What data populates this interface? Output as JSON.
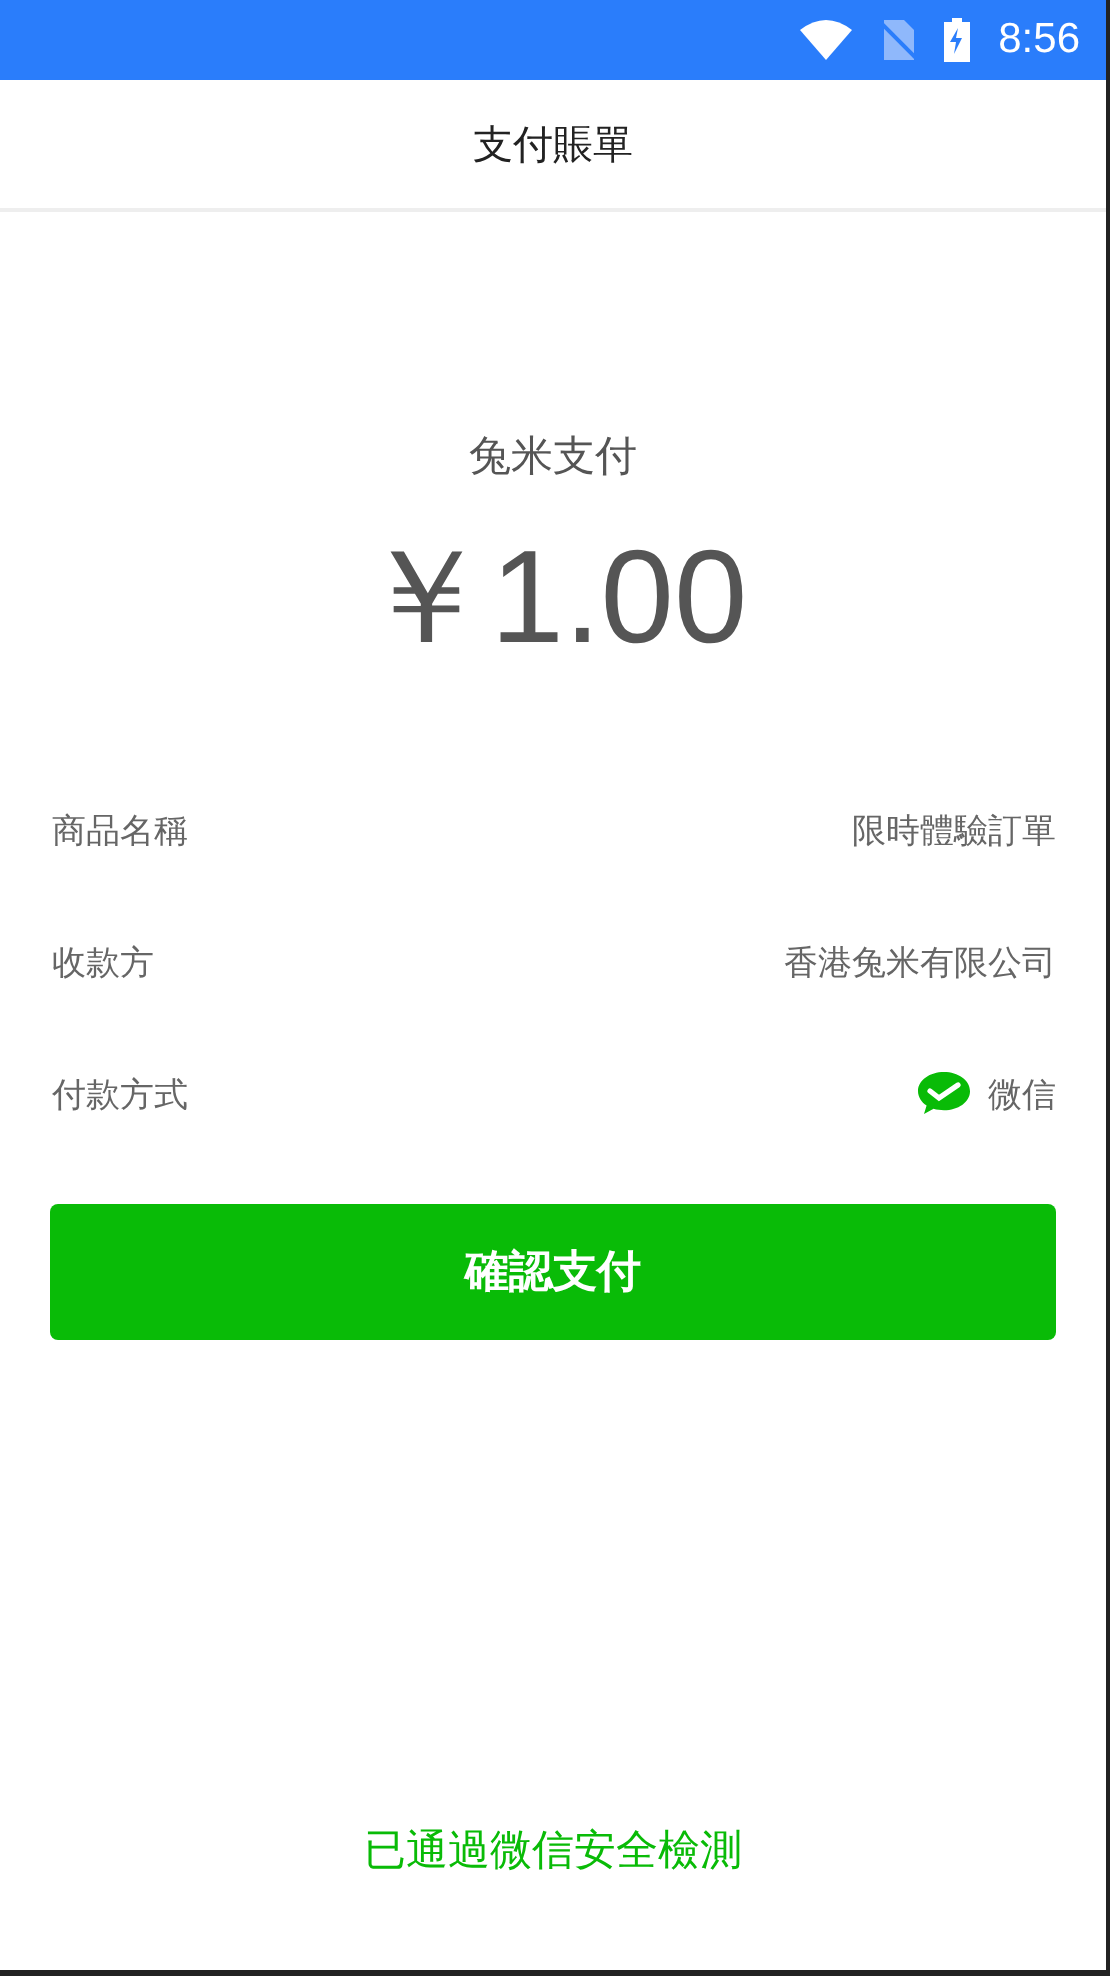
{
  "status_bar": {
    "time": "8:56"
  },
  "header": {
    "title": "支付賬單"
  },
  "payment": {
    "merchant": "兔米支付",
    "amount": "￥1.00"
  },
  "details": [
    {
      "label": "商品名稱",
      "value": "限時體驗訂單",
      "kind": "text"
    },
    {
      "label": "收款方",
      "value": "香港兔米有限公司",
      "kind": "text"
    },
    {
      "label": "付款方式",
      "value": "微信",
      "kind": "wechat"
    }
  ],
  "confirm_button": "確認支付",
  "footer": "已通過微信安全檢測"
}
